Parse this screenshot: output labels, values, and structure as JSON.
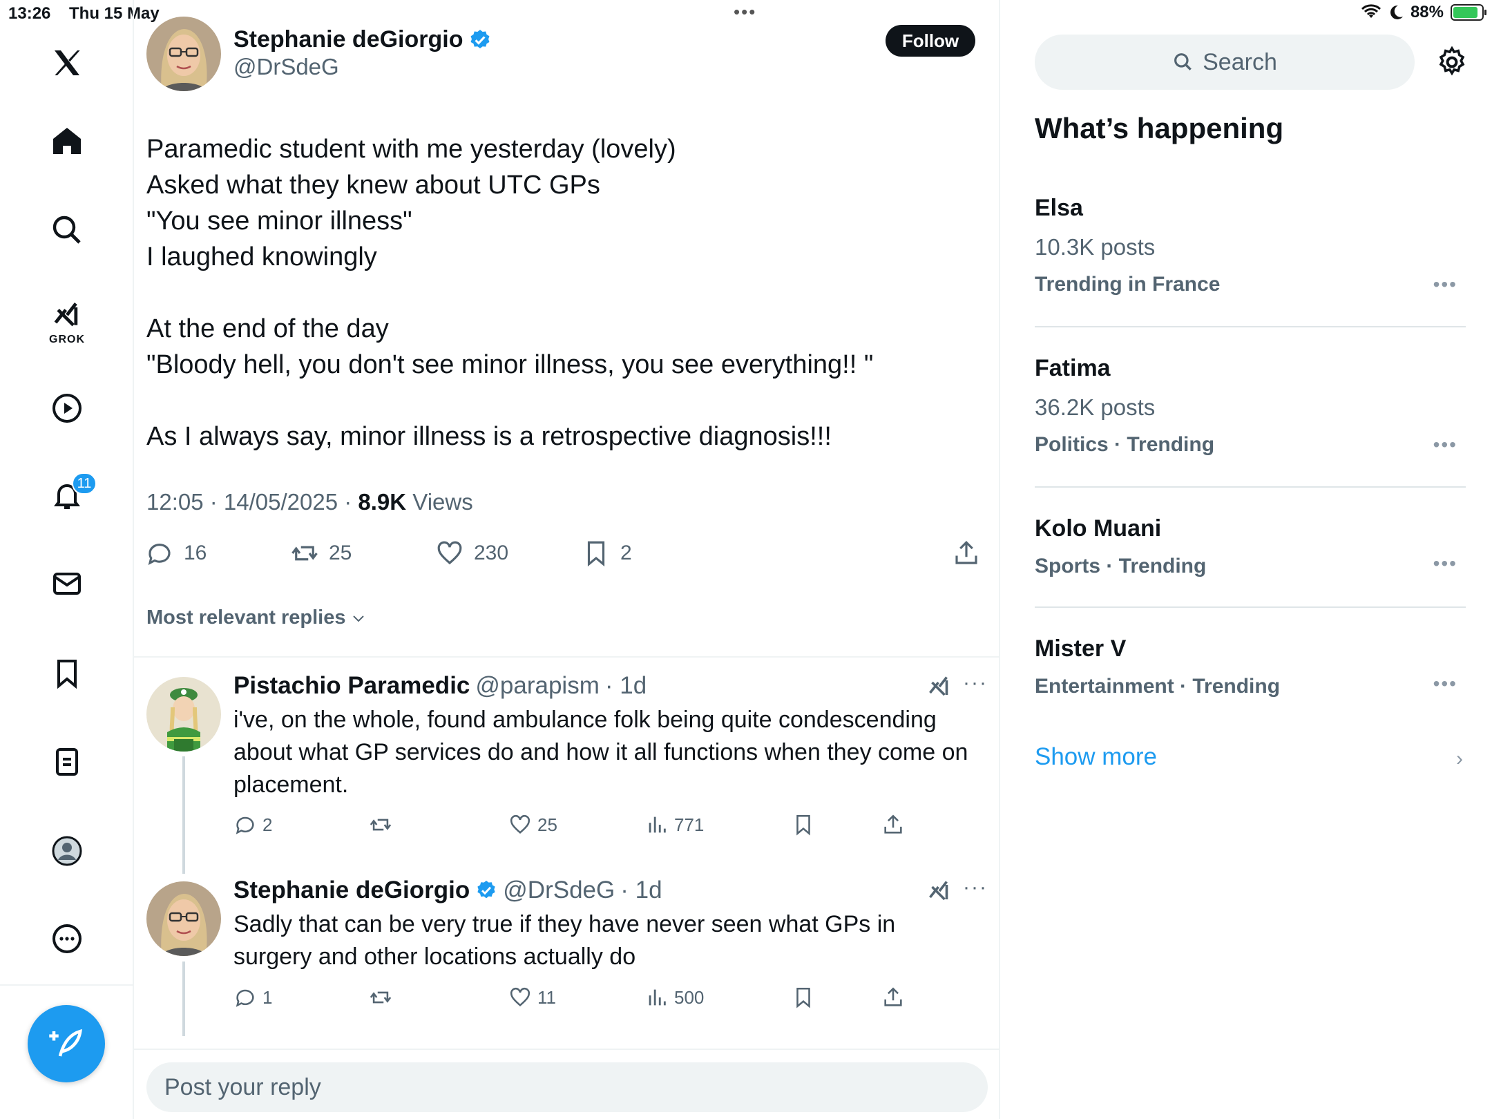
{
  "status_bar": {
    "time": "13:26",
    "date": "Thu 15 May",
    "battery": "88%",
    "battery_level": 0.88
  },
  "nav": {
    "notifications_badge": "11",
    "grok_label": "GROK"
  },
  "tweet": {
    "author_name": "Stephanie deGiorgio",
    "author_handle": "@DrSdeG",
    "follow_label": "Follow",
    "lines": [
      "Paramedic student with me yesterday (lovely)",
      "Asked what they knew about UTC GPs",
      "\"You see minor illness\"",
      "I laughed knowingly",
      "",
      "At the end of the day",
      "\"Bloody hell, you don't see minor illness, you see everything!! \"",
      "",
      "As I always say, minor illness is a retrospective diagnosis!!!"
    ],
    "timestamp": "12:05 · 14/05/2025 · ",
    "views_count": "8.9K",
    "views_label": " Views",
    "replies": "16",
    "retweets": "25",
    "likes": "230",
    "bookmarks": "2"
  },
  "sort_label": "Most relevant replies",
  "replies": [
    {
      "name": "Pistachio Paramedic",
      "handle": "@parapism",
      "age": "· 1d",
      "text": "i've, on the whole,  found ambulance folk being quite condescending about what GP services do and how it all functions when they come on placement.",
      "replies": "2",
      "likes": "25",
      "views": "771"
    },
    {
      "name": "Stephanie deGiorgio",
      "handle": "@DrSdeG",
      "age": "· 1d",
      "text": "Sadly that can be very true if they have never seen what GPs in surgery and other locations actually do",
      "replies": "1",
      "likes": "11",
      "views": "500"
    }
  ],
  "reply_placeholder": "Post your reply",
  "sidebar": {
    "search_placeholder": "Search",
    "title": "What’s happening",
    "trends": [
      {
        "name": "Elsa",
        "posts": "10.3K posts",
        "category": "Trending in France"
      },
      {
        "name": "Fatima",
        "posts": "36.2K posts",
        "category": "Politics · Trending"
      },
      {
        "name": "Kolo Muani",
        "posts": "",
        "category": "Sports · Trending"
      },
      {
        "name": "Mister V",
        "posts": "",
        "category": "Entertainment · Trending"
      }
    ],
    "show_more": "Show more"
  },
  "colors": {
    "accent": "#1d9bf0",
    "text": "#0f1419",
    "muted": "#536471"
  }
}
